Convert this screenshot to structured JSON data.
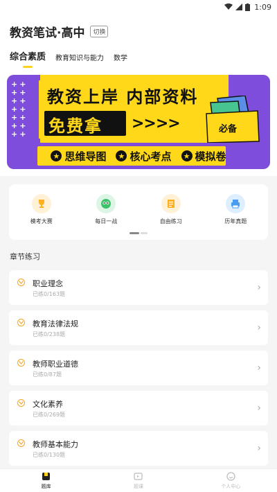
{
  "status_bar": {
    "time": "1:09"
  },
  "header": {
    "title": "教资笔试·高中",
    "switch_label": "切换",
    "tabs": [
      {
        "label": "综合素质",
        "active": true
      },
      {
        "label": "教育知识与能力",
        "active": false
      },
      {
        "label": "数学",
        "active": false
      }
    ]
  },
  "banner": {
    "line1": "教资上岸 内部资料",
    "line2": "免费拿",
    "arrows": ">>>>",
    "badge": "必备",
    "features": [
      "思维导图",
      "核心考点",
      "模拟卷"
    ]
  },
  "quick_actions": [
    {
      "label": "模考大赛",
      "icon": "trophy-icon",
      "color": "#ffb020"
    },
    {
      "label": "每日一战",
      "icon": "owl-icon",
      "color": "#3cc36a"
    },
    {
      "label": "自由练习",
      "icon": "notepad-icon",
      "color": "#ffb020"
    },
    {
      "label": "历年真题",
      "icon": "printer-icon",
      "color": "#4a9cf0"
    }
  ],
  "section_title": "章节练习",
  "chapters": [
    {
      "name": "职业理念",
      "progress": "已练0/163题"
    },
    {
      "name": "教育法律法规",
      "progress": "已练0/238题"
    },
    {
      "name": "教师职业道德",
      "progress": "已练0/87题"
    },
    {
      "name": "文化素养",
      "progress": "已练0/269题"
    },
    {
      "name": "教师基本能力",
      "progress": "已练0/130题"
    }
  ],
  "bottom_nav": [
    {
      "label": "题库",
      "icon": "question-bank-icon",
      "active": true
    },
    {
      "label": "题课",
      "icon": "video-lesson-icon",
      "active": false
    },
    {
      "label": "个人中心",
      "icon": "profile-icon",
      "active": false
    }
  ],
  "colors": {
    "accent": "#ffd31a",
    "banner_purple": "#7e4ddb",
    "banner_yellow": "#ffd819"
  }
}
